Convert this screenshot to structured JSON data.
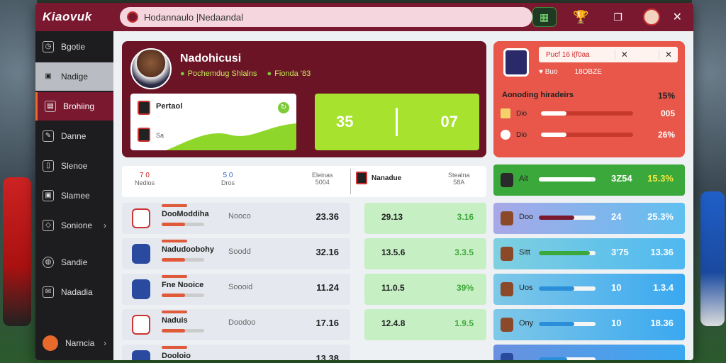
{
  "colors": {
    "brand": "#7a1830",
    "accent": "#e86a2a",
    "lime": "#a6e22e",
    "coral": "#e8574a",
    "green": "#3fa83a",
    "blue": "#3aa8e8"
  },
  "topbar": {
    "logo": "Kiaovuk",
    "search_text": "Hodannaulo |Nedaandal"
  },
  "sidebar": {
    "items": [
      {
        "label": "Bgotie",
        "icon": "clock-icon"
      },
      {
        "label": "Nadige",
        "icon": "image-icon",
        "chevron": "›"
      },
      {
        "label": "Brohiing",
        "icon": "folder-icon"
      },
      {
        "label": "Danne",
        "icon": "edit-icon"
      },
      {
        "label": "Slenoe",
        "icon": "document-icon"
      },
      {
        "label": "Slamee",
        "icon": "image-icon"
      },
      {
        "label": "Sonione",
        "icon": "diamond-icon",
        "chevron": "›"
      },
      {
        "label": "Sandie",
        "icon": "globe-icon"
      },
      {
        "label": "Nadadia",
        "icon": "mail-icon"
      }
    ],
    "bottom": {
      "label": "Narncia",
      "chevron": "›"
    }
  },
  "hero": {
    "name": "Nadohicusi",
    "meta_1": "Pochemdug Shlalns",
    "meta_2": "Fionda '83",
    "match_title": "Pertaol",
    "match_sub": "Sa",
    "score_left": "35",
    "score_right": "07"
  },
  "stats": {
    "head": "Pucf 16 i(f0aa",
    "sub_1": "Buo",
    "sub_2": "18OBZE",
    "title": "Aonoding hiradeirs",
    "pct": "15%",
    "rows": [
      {
        "label": "Dio",
        "value": "005",
        "fill": 0.28
      },
      {
        "label": "Dio",
        "value": "26%",
        "fill": 0.28
      }
    ]
  },
  "table_head": {
    "col1_top": "7  0",
    "col1_bot": "Nedios",
    "col2_top": "5  0",
    "col2_bot": "Dros",
    "col3_top": "Eleinas",
    "col3_bot": "5004",
    "team": "Nanadue",
    "col4_top": "Stealna",
    "col4_bot": "58A"
  },
  "rows": [
    {
      "name": "DooModdiha",
      "mid": "Nooco",
      "val": "23.36",
      "g_a": "29.13",
      "g_b": "3.16",
      "fill": 0.55,
      "crest": "red"
    },
    {
      "name": "Nadudoobohy",
      "mid": "Soodd",
      "val": "32.16",
      "g_a": "13.5.6",
      "g_b": "3.3.5",
      "fill": 0.55,
      "crest": "blue"
    },
    {
      "name": "Fne Nooice",
      "mid": "Soooid",
      "val": "11.24",
      "g_a": "11.0.5",
      "g_b": "39%",
      "fill": 0.55,
      "crest": "blue"
    },
    {
      "name": "Naduis",
      "mid": "Doodoo",
      "val": "17.16",
      "g_a": "12.4.8",
      "g_b": "1.9.5",
      "fill": 0.55,
      "crest": "red"
    },
    {
      "name": "Dooloio",
      "mid": "",
      "val": "13.38",
      "g_a": "",
      "g_b": "",
      "fill": 0.55,
      "crest": "blue"
    }
  ],
  "right_rows": [
    {
      "label": "Ait",
      "v1": "3Z54",
      "v2": "15.3%",
      "fill": 0.92,
      "bg": "#3aa83a",
      "bar": "#fff"
    },
    {
      "label": "Doo",
      "v1": "24",
      "v2": "25.3%",
      "fill": 0.62,
      "bg": "#a8a8e8",
      "bar": "#7a1830"
    },
    {
      "label": "Sitt",
      "v1": "3'75",
      "v2": "13.36",
      "fill": 0.9,
      "bg": "#4fbfe0",
      "bar": "#3aa83a"
    },
    {
      "label": "Uos",
      "v1": "10",
      "v2": "1.3.4",
      "fill": 0.62,
      "bg": "#4fa8e8",
      "bar": "#2a8fd8"
    },
    {
      "label": "Ony",
      "v1": "10",
      "v2": "18.36",
      "fill": 0.62,
      "bg": "#4fb8e0",
      "bar": "#2a8fd8"
    },
    {
      "label": "",
      "v1": "",
      "v2": "",
      "fill": 0.5,
      "bg": "#6a90e0",
      "bar": "#2a8fd8"
    }
  ]
}
